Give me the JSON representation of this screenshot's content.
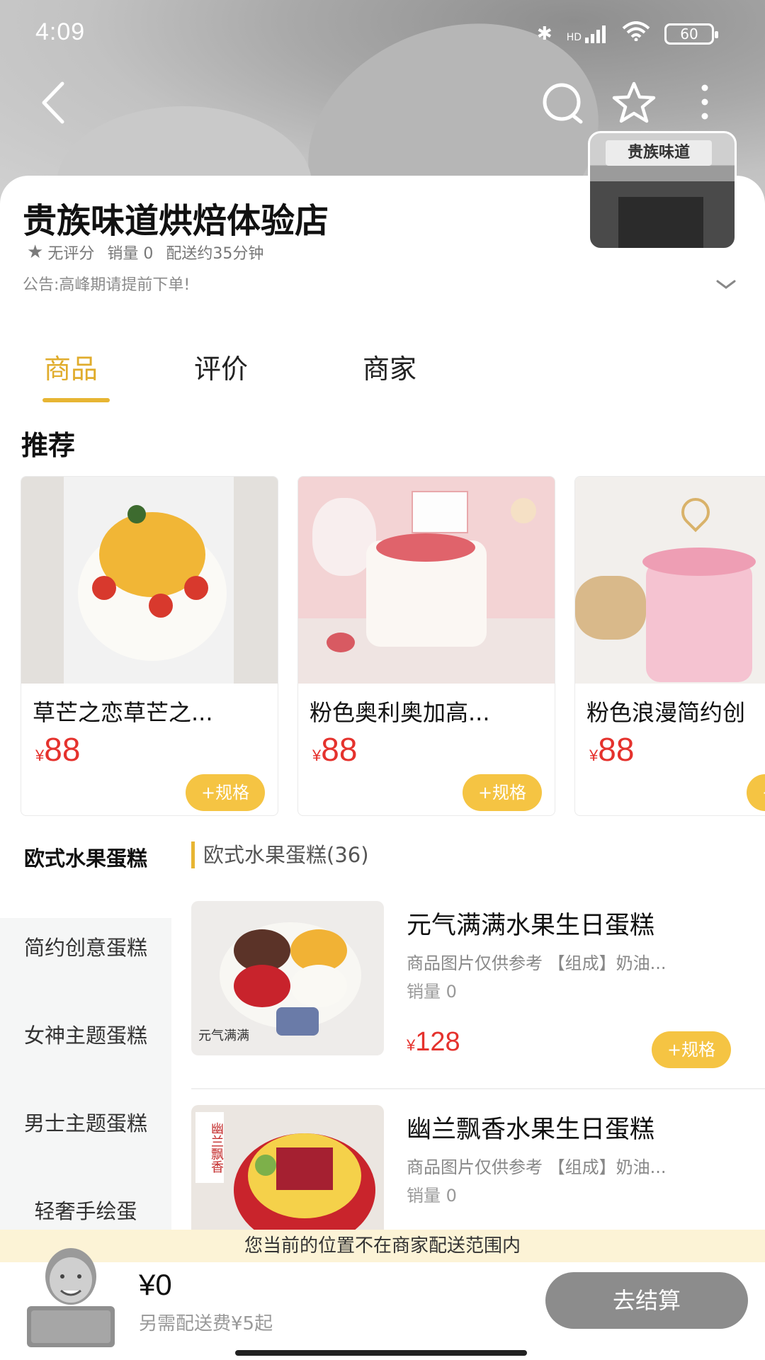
{
  "status": {
    "time": "4:09",
    "battery": "60",
    "signal_label": "HD"
  },
  "store": {
    "name": "贵族味道烘焙体验店",
    "rating": "无评分",
    "sales": "销量 0",
    "delivery": "配送约35分钟",
    "notice": "公告:高峰期请提前下单!",
    "storefront_sign": "贵族味道"
  },
  "tabs": [
    {
      "label": "商品",
      "active": true
    },
    {
      "label": "评价",
      "active": false
    },
    {
      "label": "商家",
      "active": false
    }
  ],
  "recommend": {
    "title": "推荐",
    "items": [
      {
        "name": "草芒之恋草芒之...",
        "currency": "¥",
        "price": "88",
        "button": "+规格"
      },
      {
        "name": "粉色奥利奥加高...",
        "currency": "¥",
        "price": "88",
        "button": "+规格"
      },
      {
        "name": "粉色浪漫简约创",
        "currency": "¥",
        "price": "88",
        "button": "+规格"
      }
    ]
  },
  "categories": [
    {
      "label": "欧式水果蛋糕",
      "active": true
    },
    {
      "label": "简约创意蛋糕",
      "active": false
    },
    {
      "label": "女神主题蛋糕",
      "active": false
    },
    {
      "label": "男士主题蛋糕",
      "active": false
    },
    {
      "label": "轻奢手绘蛋",
      "active": false
    }
  ],
  "list": {
    "title": "欧式水果蛋糕(36)",
    "items": [
      {
        "name": "元气满满水果生日蛋糕",
        "desc": "商品图片仅供参考 【组成】奶油...",
        "sales": "销量 0",
        "currency": "¥",
        "price": "128",
        "button": "+规格",
        "thumb_text": "元气满满"
      },
      {
        "name": "幽兰飘香水果生日蛋糕",
        "desc": "商品图片仅供参考 【组成】奶油...",
        "sales": "销量 0",
        "thumb_text": "幽兰飘香"
      }
    ]
  },
  "bottom": {
    "delivery_notice": "您当前的位置不在商家配送范围内",
    "total": "¥0",
    "fee": "另需配送费¥5起",
    "checkout": "去结算"
  },
  "colors": {
    "accent": "#e7b533",
    "price": "#e5322d",
    "button": "#f5c443",
    "checkout": "#8c8c8c"
  }
}
